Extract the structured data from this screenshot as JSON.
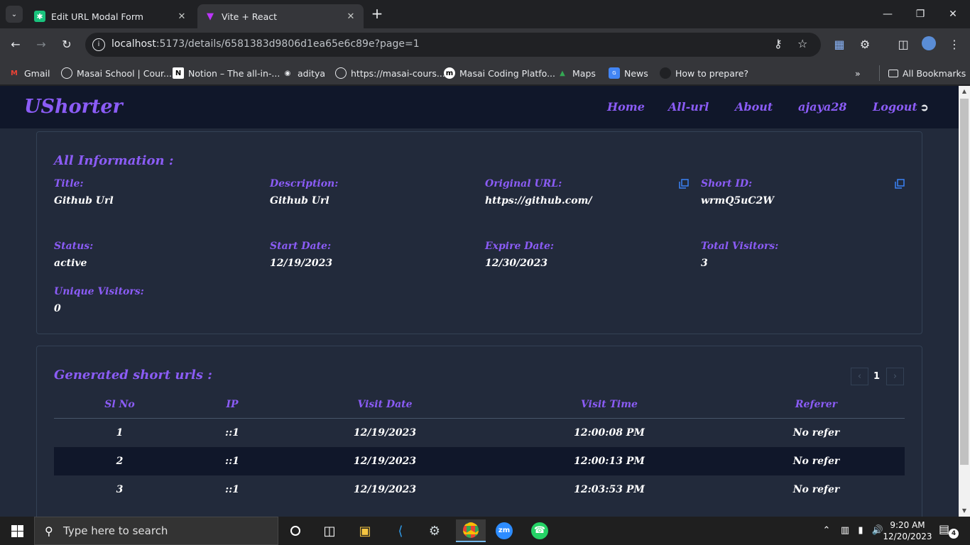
{
  "browser": {
    "tabs": [
      {
        "title": "Edit URL Modal Form"
      },
      {
        "title": "Vite + React"
      }
    ],
    "address": {
      "host": "localhost",
      "rest": ":5173/details/6581383d9806d1ea65e6c89e?page=1"
    },
    "bookmarks": [
      {
        "label": "Gmail"
      },
      {
        "label": "Masai School | Cour..."
      },
      {
        "label": "Notion – The all-in-..."
      },
      {
        "label": "aditya"
      },
      {
        "label": "https://masai-cours..."
      },
      {
        "label": "Masai Coding Platfo..."
      },
      {
        "label": "Maps"
      },
      {
        "label": "News"
      },
      {
        "label": "How to prepare?"
      }
    ],
    "all_bookmarks": "All Bookmarks"
  },
  "app": {
    "brand": "UShorter",
    "nav": {
      "home": "Home",
      "all_url": "All-url",
      "about": "About",
      "user": "ajaya28",
      "logout": "Logout"
    }
  },
  "info": {
    "heading": "All Information :",
    "fields": {
      "title": {
        "label": "Title:",
        "value": "Github Url"
      },
      "description": {
        "label": "Description:",
        "value": "Github Url"
      },
      "original_url": {
        "label": "Original URL:",
        "value": "https://github.com/"
      },
      "short_id": {
        "label": "Short ID:",
        "value": "wrmQ5uC2W"
      },
      "status": {
        "label": "Status:",
        "value": "active"
      },
      "start_date": {
        "label": "Start Date:",
        "value": "12/19/2023"
      },
      "expire_date": {
        "label": "Expire Date:",
        "value": "12/30/2023"
      },
      "total_visitors": {
        "label": "Total Visitors:",
        "value": "3"
      },
      "unique_visitors": {
        "label": "Unique Visitors:",
        "value": "0"
      }
    }
  },
  "visits": {
    "heading": "Generated short urls :",
    "page": "1",
    "columns": [
      "Sl No",
      "IP",
      "Visit Date",
      "Visit Time",
      "Referer"
    ],
    "rows": [
      [
        "1",
        "::1",
        "12/19/2023",
        "12:00:08 PM",
        "No refer"
      ],
      [
        "2",
        "::1",
        "12/19/2023",
        "12:00:13 PM",
        "No refer"
      ],
      [
        "3",
        "::1",
        "12/19/2023",
        "12:03:53 PM",
        "No refer"
      ]
    ]
  },
  "taskbar": {
    "search_placeholder": "Type here to search",
    "time": "9:20 AM",
    "date": "12/20/2023",
    "notification_count": "4"
  },
  "colors": {
    "accent": "#8b5cf6",
    "page_bg": "#222a3b",
    "navbar_bg": "#10172a",
    "copy_icon": "#3b82f6"
  }
}
